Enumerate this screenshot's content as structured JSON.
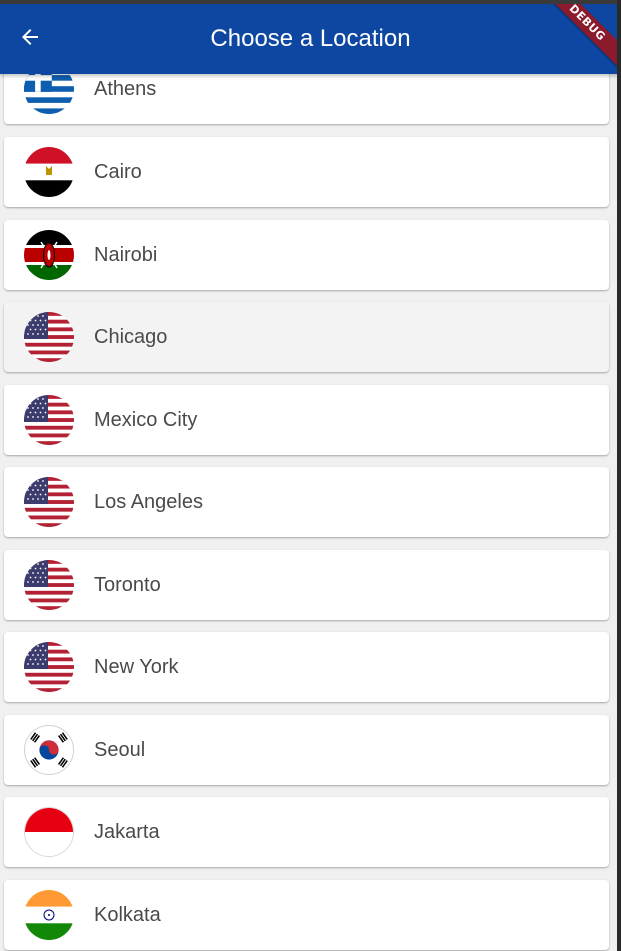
{
  "app_bar": {
    "title": "Choose a Location",
    "back_icon": "arrow-back-icon",
    "background": "#0d47a1",
    "debug_banner": "DEBUG"
  },
  "locations": [
    {
      "city": "Athens",
      "flag_icon": "greece-flag-icon"
    },
    {
      "city": "Cairo",
      "flag_icon": "egypt-flag-icon"
    },
    {
      "city": "Nairobi",
      "flag_icon": "kenya-flag-icon"
    },
    {
      "city": "Chicago",
      "flag_icon": "usa-flag-icon"
    },
    {
      "city": "Mexico City",
      "flag_icon": "usa-flag-icon"
    },
    {
      "city": "Los Angeles",
      "flag_icon": "usa-flag-icon"
    },
    {
      "city": "Toronto",
      "flag_icon": "usa-flag-icon"
    },
    {
      "city": "New York",
      "flag_icon": "usa-flag-icon"
    },
    {
      "city": "Seoul",
      "flag_icon": "south-korea-flag-icon"
    },
    {
      "city": "Jakarta",
      "flag_icon": "indonesia-flag-icon"
    },
    {
      "city": "Kolkata",
      "flag_icon": "india-flag-icon"
    }
  ]
}
